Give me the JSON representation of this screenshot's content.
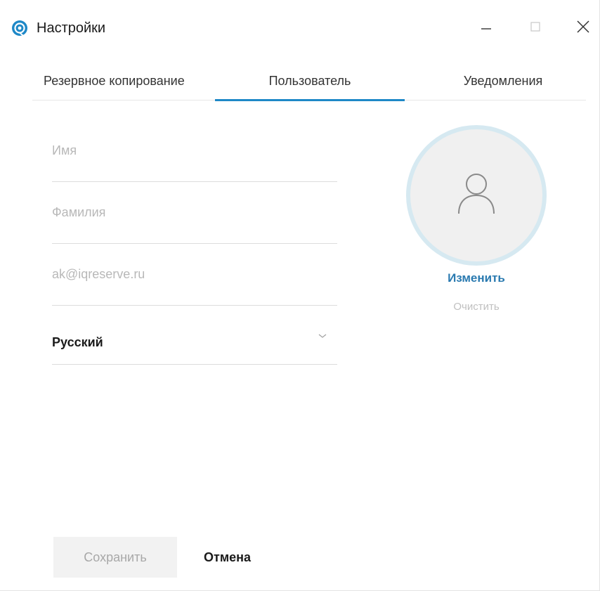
{
  "window": {
    "title": "Настройки",
    "app_icon": "iqreserve-logo-icon",
    "controls": [
      "minimize-icon",
      "maximize-icon",
      "close-icon"
    ]
  },
  "tabs": [
    {
      "label": "Резервное копирование",
      "active": false
    },
    {
      "label": "Пользователь",
      "active": true
    },
    {
      "label": "Уведомления",
      "active": false
    }
  ],
  "form": {
    "first_name": {
      "value": "",
      "placeholder": "Имя"
    },
    "last_name": {
      "value": "",
      "placeholder": "Фамилия"
    },
    "email": {
      "value": "",
      "placeholder": "ak@iqreserve.ru"
    },
    "language": {
      "selected": "Русский",
      "icon": "chevron-down-icon"
    }
  },
  "avatar": {
    "icon": "user-icon",
    "change_label": "Изменить",
    "clear_label": "Очистить"
  },
  "actions": {
    "save_label": "Сохранить",
    "cancel_label": "Отмена"
  },
  "colors": {
    "accent": "#1e88c7",
    "link": "#2a7ab0",
    "avatar_ring": "#d6e9f1",
    "avatar_fill": "#f0f0f0",
    "disabled_text": "#a8a8a8"
  }
}
